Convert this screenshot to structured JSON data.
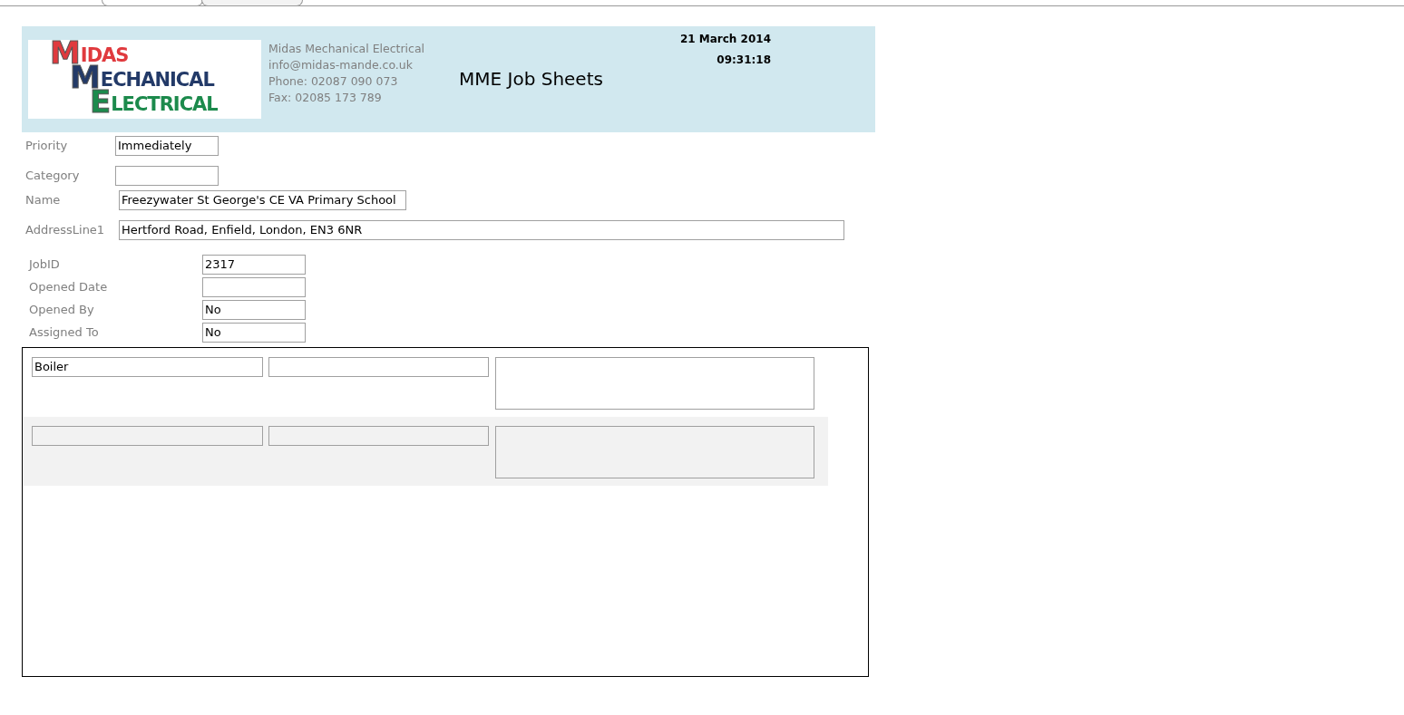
{
  "tabs": [
    {
      "selected": true
    },
    {
      "selected": false
    }
  ],
  "header": {
    "logo": [
      {
        "initial": "M",
        "rest": "IDAS",
        "color": "#e03a3e"
      },
      {
        "initial": "M",
        "rest": "ECHANICAL",
        "color": "#233a68"
      },
      {
        "initial": "E",
        "rest": "LECTRICAL",
        "color": "#1c8a4c"
      }
    ],
    "contact": [
      "Midas Mechanical Electrical",
      "info@midas-mande.co.uk",
      "Phone: 02087 090 073",
      "Fax: 02085 173 789"
    ],
    "title": "MME Job Sheets",
    "date": "21 March 2014",
    "time": "09:31:18"
  },
  "customer_fields": [
    {
      "label": "Priority",
      "value": "Immediately",
      "kind": "short"
    },
    {
      "label": "Category",
      "kind": "short"
    },
    {
      "label": "Name",
      "value": "Freezywater St George's CE VA Primary School",
      "kind": "medium"
    },
    {
      "label": "AddressLine1",
      "value": "Hertford Road, Enfield, London, EN3 6NR",
      "kind": "long"
    }
  ],
  "job_fields": [
    {
      "label": "JobID",
      "value": "2317"
    },
    {
      "label": "Opened Date"
    },
    {
      "label": "Opened By",
      "value": "No"
    },
    {
      "label": "Assigned To",
      "value": "No"
    }
  ],
  "subform": {
    "rows": [
      {
        "kind": "record",
        "column_1": "Boiler"
      },
      {
        "kind": "new"
      }
    ]
  }
}
